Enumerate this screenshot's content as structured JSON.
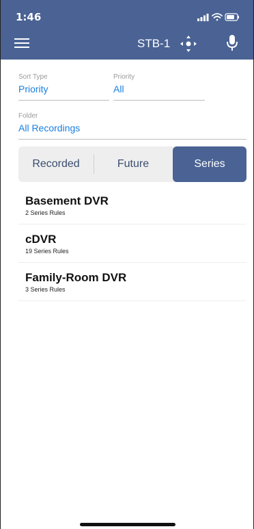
{
  "status_bar": {
    "time": "1:46"
  },
  "nav": {
    "device_label": "STB-1"
  },
  "filters": {
    "sort_type": {
      "label": "Sort Type",
      "value": "Priority"
    },
    "priority": {
      "label": "Priority",
      "value": "All"
    },
    "folder": {
      "label": "Folder",
      "value": "All Recordings"
    }
  },
  "segments": {
    "recorded": "Recorded",
    "future": "Future",
    "series": "Series",
    "selected": "Series"
  },
  "dvr_list": [
    {
      "name": "Basement DVR",
      "subtitle": "2 Series Rules"
    },
    {
      "name": "cDVR",
      "subtitle": "19 Series Rules"
    },
    {
      "name": "Family-Room DVR",
      "subtitle": "3 Series Rules"
    }
  ],
  "colors": {
    "header_bg": "#4a6394",
    "accent_link": "#1a7fe0",
    "segment_bg": "#eeeeee"
  }
}
